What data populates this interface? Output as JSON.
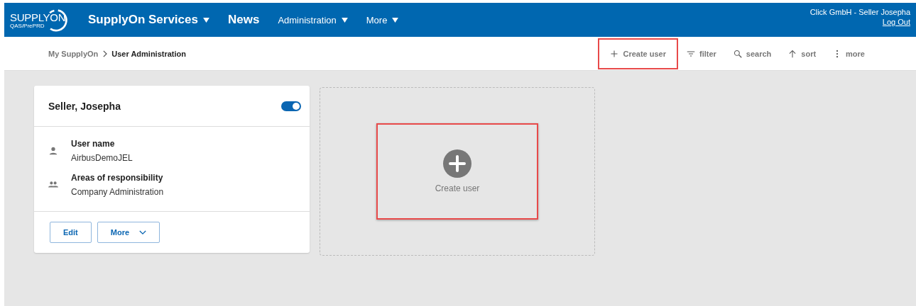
{
  "header": {
    "logo": {
      "text": "SUPPLYON",
      "env": "QAS/PrePRD"
    },
    "nav": [
      {
        "label": "SupplyOn Services",
        "dropdown": true,
        "kind": "primary"
      },
      {
        "label": "News",
        "dropdown": false,
        "kind": "primary"
      },
      {
        "label": "Administration",
        "dropdown": true,
        "kind": "secondary"
      },
      {
        "label": "More",
        "dropdown": true,
        "kind": "secondary"
      }
    ],
    "user": "Click GmbH - Seller Josepha",
    "logout": "Log Out"
  },
  "breadcrumb": [
    {
      "label": "My SupplyOn",
      "current": false
    },
    {
      "label": "User Administration",
      "current": true
    }
  ],
  "toolbar": [
    {
      "kind": "add",
      "label": "Create user",
      "highlighted": true
    },
    {
      "kind": "filter",
      "label": "filter",
      "highlighted": false
    },
    {
      "kind": "search",
      "label": "search",
      "highlighted": false
    },
    {
      "kind": "sort",
      "label": "sort",
      "highlighted": false
    },
    {
      "kind": "more",
      "label": "more",
      "highlighted": false
    }
  ],
  "user_card": {
    "name": "Seller, Josepha",
    "active": true,
    "fields": [
      {
        "kind": "person",
        "label": "User name",
        "value": "AirbusDemoJEL"
      },
      {
        "kind": "group",
        "label": "Areas of responsibility",
        "value": "Company Administration"
      }
    ],
    "buttons": [
      {
        "label": "Edit",
        "dropdown": false
      },
      {
        "label": "More",
        "dropdown": true
      }
    ]
  },
  "create_tile": {
    "label": "Create user",
    "highlighted": true
  }
}
